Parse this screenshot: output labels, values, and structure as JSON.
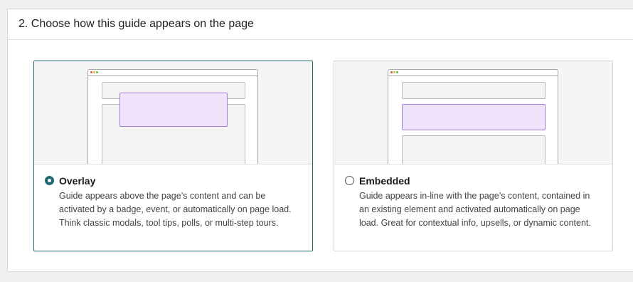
{
  "section": {
    "title": "2. Choose how this guide appears on the page"
  },
  "options": [
    {
      "title": "Overlay",
      "description": "Guide appears above the page’s content and can be activated by a badge, event, or automatically on page load. Think classic modals, tool tips, polls, or multi-step tours.",
      "selected": true
    },
    {
      "title": "Embedded",
      "description": "Guide appears in-line with the page’s content, contained in an existing element and activated automatically on page load. Great for contextual info, upsells, or dynamic content.",
      "selected": false
    }
  ],
  "colors": {
    "accent": "#1f6a72",
    "highlight_fill": "#efe2fb",
    "highlight_border": "#a77fd9"
  },
  "icons": {
    "browser_dots": [
      "red-dot-icon",
      "yellow-dot-icon",
      "green-dot-icon"
    ]
  }
}
